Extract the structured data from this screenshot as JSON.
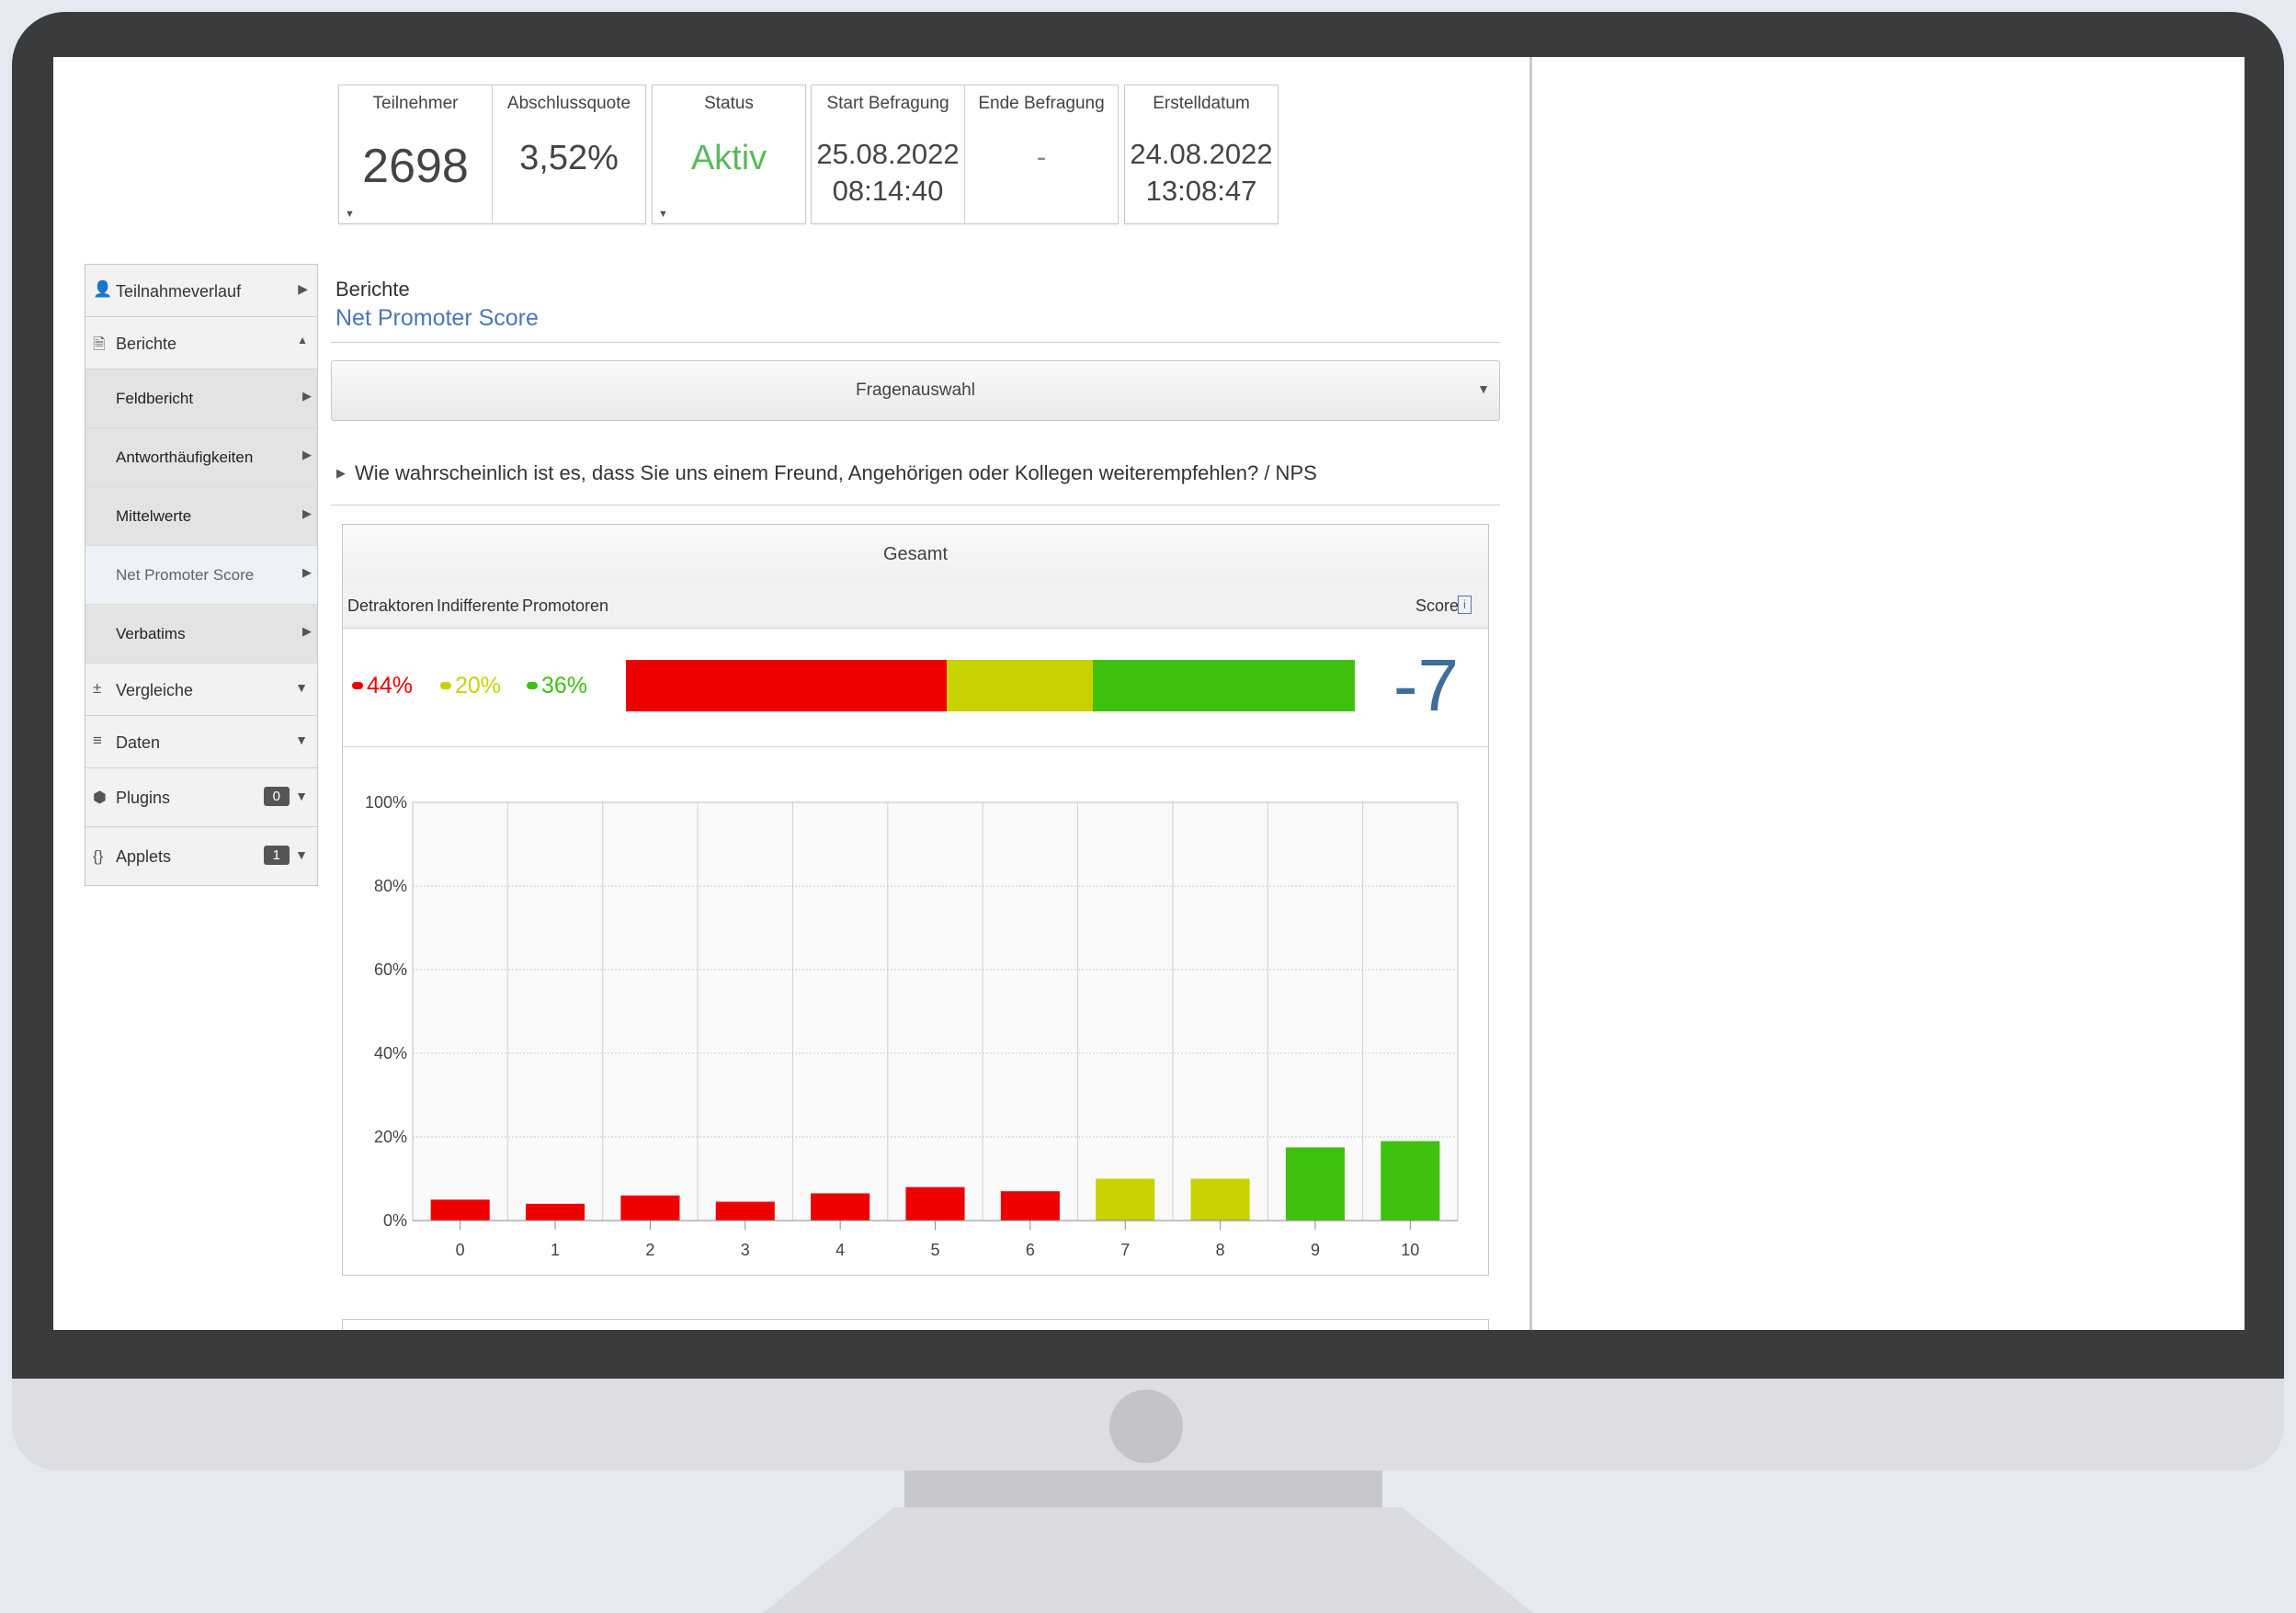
{
  "stats": {
    "participants": {
      "label": "Teilnehmer",
      "value": "2698"
    },
    "completion": {
      "label": "Abschlussquote",
      "value": "3,52%"
    },
    "status": {
      "label": "Status",
      "value": "Aktiv",
      "color": "#5cb85c"
    },
    "start": {
      "label": "Start Befragung",
      "date": "25.08.2022",
      "time": "08:14:40"
    },
    "end": {
      "label": "Ende Befragung",
      "value": "-"
    },
    "created": {
      "label": "Erstelldatum",
      "date": "24.08.2022",
      "time": "13:08:47"
    }
  },
  "sidebar": {
    "participation": "Teilnahmeverlauf",
    "reports": "Berichte",
    "sub_items": [
      "Feldbericht",
      "Antworthäufigkeiten",
      "Mittelwerte",
      "Net Promoter Score",
      "Verbatims"
    ],
    "comparisons": "Vergleiche",
    "data": "Daten",
    "plugins": {
      "label": "Plugins",
      "count": "0"
    },
    "applets": {
      "label": "Applets",
      "count": "1"
    }
  },
  "main": {
    "section": "Berichte",
    "title": "Net Promoter Score",
    "dropdown": "Fragenauswahl",
    "question": "Wie wahrscheinlich ist es, dass Sie uns einem Freund, Angehörigen oder Kollegen weiterempfehlen? / NPS"
  },
  "panel": {
    "title": "Gesamt",
    "col_detractors": "Detraktoren",
    "col_passives": "Indifferente",
    "col_promoters": "Promotoren",
    "score_label": "Score",
    "detractors_pct": "44%",
    "passives_pct": "20%",
    "promoters_pct": "36%",
    "score": "-7",
    "colors": {
      "detractors": "#ef0000",
      "passives": "#c8d200",
      "promoters": "#3ec20e",
      "score": "#3d6f99"
    }
  },
  "chart_data": {
    "type": "bar",
    "categories": [
      "0",
      "1",
      "2",
      "3",
      "4",
      "5",
      "6",
      "7",
      "8",
      "9",
      "10"
    ],
    "values": [
      5,
      4,
      6,
      4.5,
      6.5,
      8,
      7,
      10,
      10,
      17.5,
      19
    ],
    "colors": [
      "#ef0000",
      "#ef0000",
      "#ef0000",
      "#ef0000",
      "#ef0000",
      "#ef0000",
      "#ef0000",
      "#c8d200",
      "#c8d200",
      "#3ec20e",
      "#3ec20e"
    ],
    "yticks": [
      "0%",
      "20%",
      "40%",
      "60%",
      "80%",
      "100%"
    ],
    "ylim": [
      0,
      100
    ],
    "grid": true
  }
}
